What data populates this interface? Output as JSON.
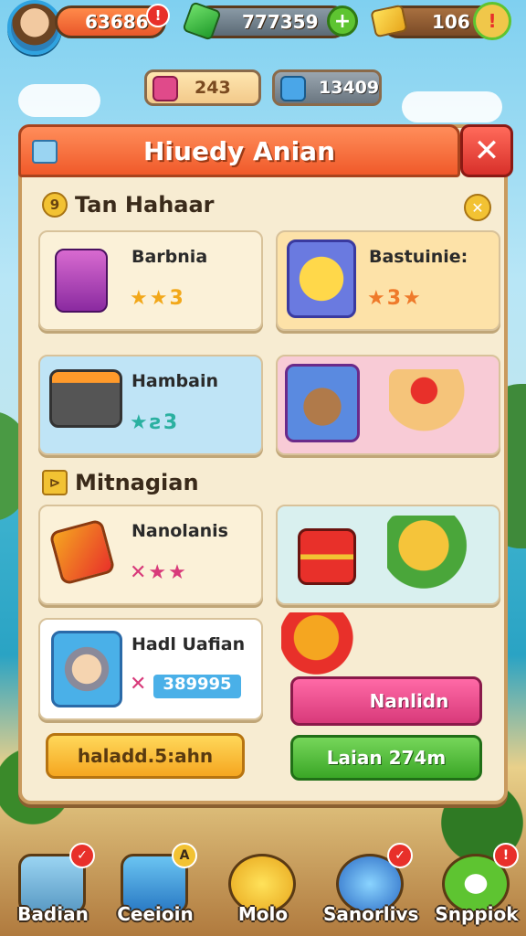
{
  "top_bar": {
    "coins_value": "63686",
    "coins_badge": "!",
    "gems_value": "777359",
    "gems_plus": "+",
    "gold_value": "106",
    "gold_badge": "!"
  },
  "sub_bar": {
    "ticket_value": "243",
    "energy_value": "13409"
  },
  "panel": {
    "title": "Hiuedy Anian",
    "close": "✕",
    "section1": {
      "title": "Tan Hahaar",
      "icon": "9"
    },
    "section2": {
      "title": "Mitnagian",
      "icon": "⊳"
    },
    "cards": [
      {
        "title": "Barbnia",
        "stars": "★★3"
      },
      {
        "title": "Bastuinie:",
        "stars": "★3★"
      },
      {
        "title": "Hambain",
        "stars": "★ƨ3"
      },
      {
        "title": "",
        "stars": ""
      },
      {
        "title": "Nanolanis",
        "stars": "✕★★"
      },
      {
        "title": "",
        "stars": ""
      },
      {
        "title": "Hadl Uafian",
        "stars": "✕",
        "value": "389995"
      }
    ],
    "pink_button": "Nanlidn",
    "yellow_button": "haladd.5:ahn",
    "green_button": "Laian 274m"
  },
  "bottom_nav": [
    {
      "label": "Badian",
      "badge": "✓"
    },
    {
      "label": "Ceeioin",
      "badge": "A"
    },
    {
      "label": "Molo",
      "badge": ""
    },
    {
      "label": "Sanorlivs",
      "badge": "✓"
    },
    {
      "label": "Snppiok",
      "badge": "!"
    }
  ],
  "colors": {
    "panel_bg": "#f7ecd2",
    "header": "#f05a2a",
    "close": "#d8302a",
    "accent_green": "#3aa626",
    "accent_yellow": "#f5a620",
    "accent_pink": "#d83a7a"
  }
}
